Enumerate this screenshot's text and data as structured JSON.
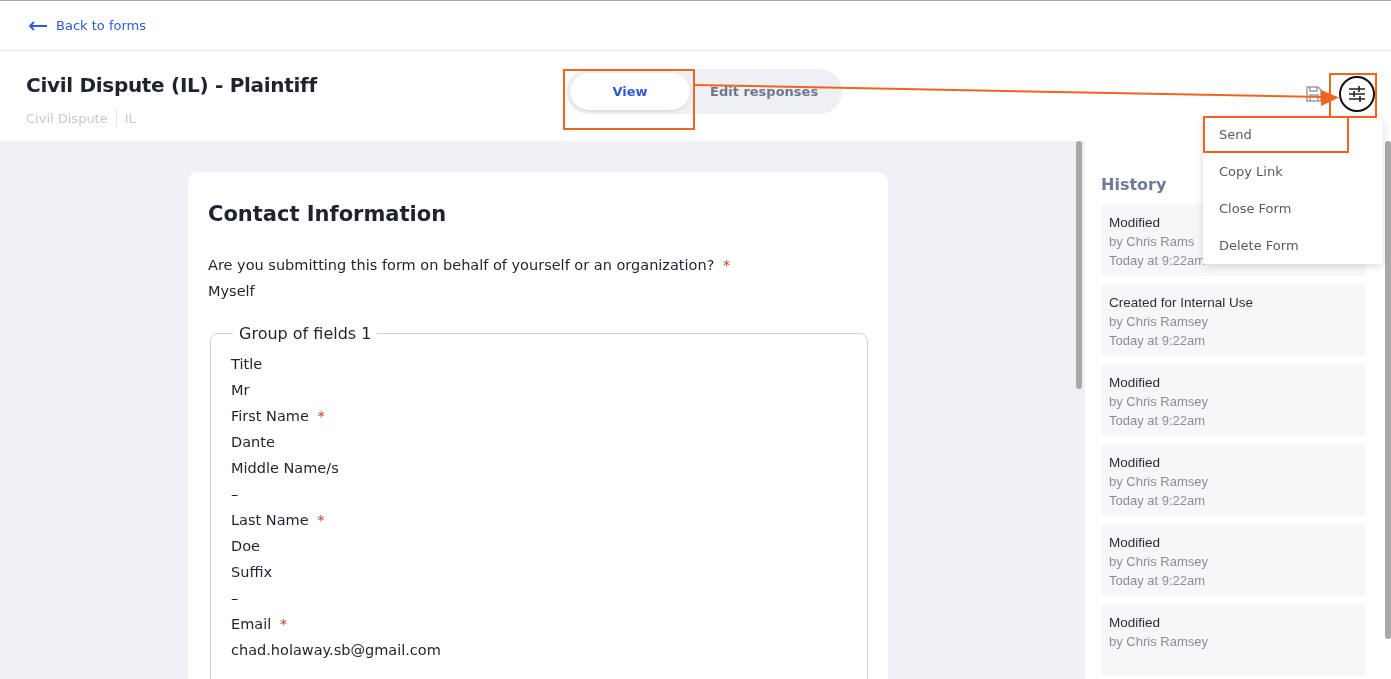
{
  "back_link": "Back to forms",
  "header": {
    "title": "Civil Dispute (IL) - Plaintiff",
    "tags": [
      "Civil Dispute",
      "IL"
    ]
  },
  "tabs": [
    {
      "label": "View",
      "selected": true
    },
    {
      "label": "Edit responses",
      "selected": false
    }
  ],
  "menu": [
    {
      "label": "Send",
      "highlighted": true
    },
    {
      "label": "Copy Link",
      "highlighted": false
    },
    {
      "label": "Close Form",
      "highlighted": false
    },
    {
      "label": "Delete Form",
      "highlighted": false
    }
  ],
  "form": {
    "section_title": "Contact Information",
    "question": {
      "label": "Are you submitting this form on behalf of yourself or an organization?",
      "required_mark": "*",
      "value": "Myself"
    },
    "group": {
      "legend": "Group of fields 1",
      "fields": [
        {
          "label": "Title",
          "value": "Mr"
        },
        {
          "label": "First Name",
          "required_mark": "*",
          "value": "Dante"
        },
        {
          "label": "Middle Name/s",
          "value": "–"
        },
        {
          "label": "Last Name",
          "required_mark": "*",
          "value": "Doe"
        },
        {
          "label": "Suffix",
          "value": "–"
        },
        {
          "label": "Email",
          "required_mark": "*",
          "value": "chad.holaway.sb@gmail.com"
        }
      ]
    }
  },
  "history": {
    "title": "History",
    "entries": [
      {
        "action": "Modified",
        "by": "by Chris Rams",
        "time": "Today at 9:22am"
      },
      {
        "action": "Created for Internal Use",
        "by": "by Chris Ramsey",
        "time": "Today at 9:22am"
      },
      {
        "action": "Modified",
        "by": "by Chris Ramsey",
        "time": "Today at 9:22am"
      },
      {
        "action": "Modified",
        "by": "by Chris Ramsey",
        "time": "Today at 9:22am"
      },
      {
        "action": "Modified",
        "by": "by Chris Ramsey",
        "time": "Today at 9:22am"
      },
      {
        "action": "Modified",
        "by": "by Chris Ramsey"
      }
    ]
  }
}
